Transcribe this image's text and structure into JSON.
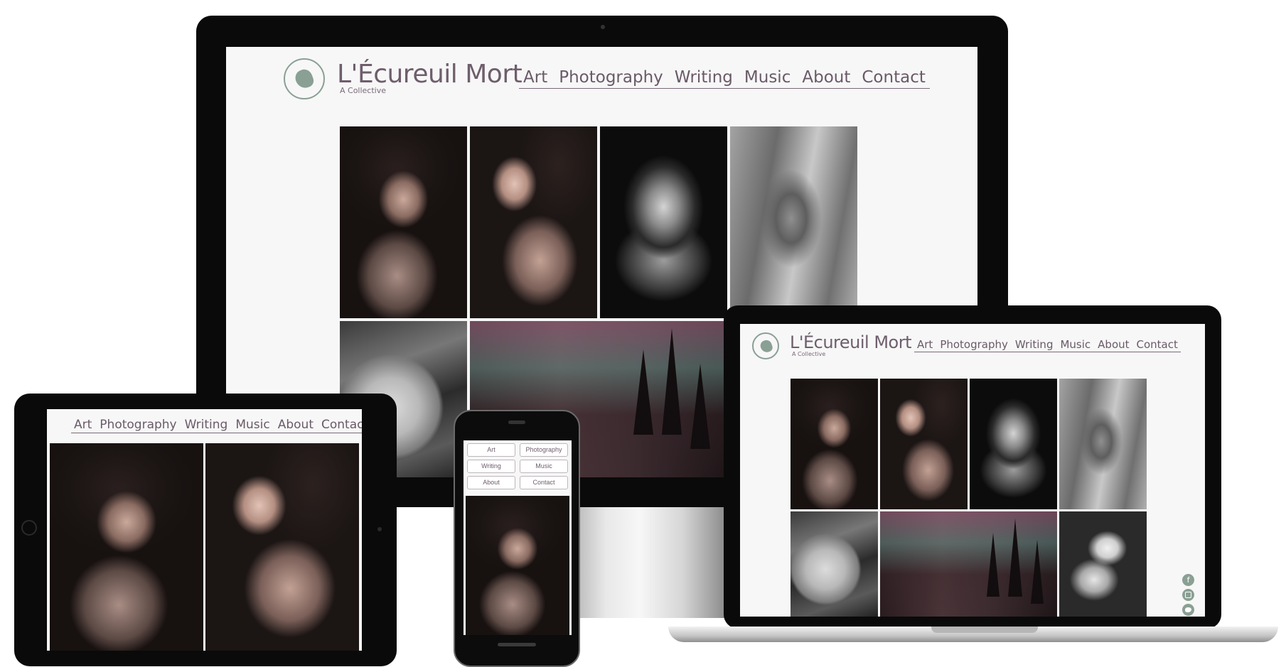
{
  "site": {
    "title": "L'Écureuil Mort",
    "subtitle": "A Collective",
    "nav": [
      "Art",
      "Photography",
      "Writing",
      "Music",
      "About",
      "Contact"
    ]
  },
  "desktop": {
    "photos": [
      "portrait-hands",
      "portrait-profile",
      "hands-over-face",
      "blonde-portrait",
      "moon-branches",
      "misty-forest"
    ]
  },
  "laptop": {
    "photos": [
      "portrait-hands",
      "portrait-profile",
      "hands-over-face",
      "blonde-portrait",
      "moon-branches",
      "misty-forest",
      "white-flowers"
    ],
    "social_icons": [
      "facebook-icon",
      "instagram-icon",
      "twitter-icon"
    ]
  },
  "tablet": {
    "photos": [
      "portrait-hands",
      "portrait-profile"
    ]
  },
  "phone": {
    "menu_buttons": [
      "Art",
      "Photography",
      "Writing",
      "Music",
      "About",
      "Contact"
    ],
    "photos": [
      "portrait-hands"
    ]
  },
  "colors": {
    "accent": "#6e5e6c",
    "logo": "#8aa094",
    "bezel": "#0a0a0a"
  }
}
